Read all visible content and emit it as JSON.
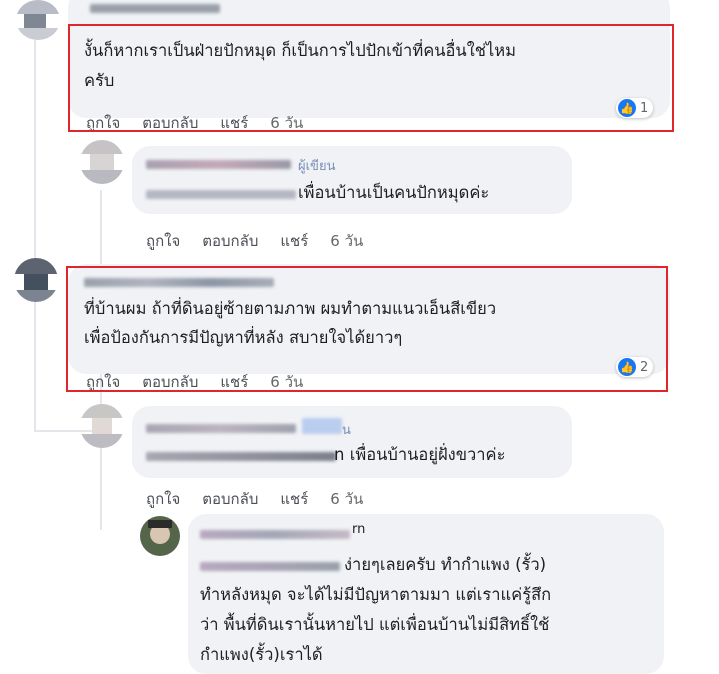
{
  "comments": [
    {
      "lines": [
        "งั้นก็หากเราเป็นฝ่ายปักหมุด ก็เป็นการไปปักเข้าที่คนอื่นใช่ไหม",
        "ครับ"
      ],
      "actions": {
        "like": "ถูกใจ",
        "reply": "ตอบกลับ",
        "share": "แชร์",
        "time": "6 วัน"
      },
      "reaction_count": "1"
    },
    {
      "author_badge": "ผู้เขียน",
      "lines": [
        "เพื่อนบ้านเป็นคนปักหมุดค่ะ"
      ],
      "actions": {
        "like": "ถูกใจ",
        "reply": "ตอบกลับ",
        "share": "แชร์",
        "time": "6 วัน"
      }
    },
    {
      "lines": [
        "ที่บ้านผม ถ้าที่ดินอยู่ซ้ายตามภาพ ผมทำตามแนวเอ็นสีเขียว",
        "เพื่อป้องกันการมีปัญหาที่หลัง สบายใจได้ยาวๆ"
      ],
      "actions": {
        "like": "ถูกใจ",
        "reply": "ตอบกลับ",
        "share": "แชร์",
        "time": "6 วัน"
      },
      "reaction_count": "2"
    },
    {
      "author_fragment": "น",
      "lines": [
        "n เพื่อนบ้านอยู่ฝั่งขวาค่ะ"
      ],
      "actions": {
        "like": "ถูกใจ",
        "reply": "ตอบกลับ",
        "share": "แชร์",
        "time": "6 วัน"
      }
    },
    {
      "author_fragment": "rn",
      "lines": [
        "ง่ายๆเลยครับ ทำกำแพง (รั้ว)",
        "ทำหลังหมุด จะได้ไม่มีปัญหาตามมา แต่เราแค่รู้สึก",
        "ว่า พื้นที่ดินเรานั้นหายไป แต่เพื่อนบ้านไม่มีสิทธิ์ใช้",
        "กำแพง(รั้ว)เราได้"
      ]
    }
  ],
  "colors": {
    "highlight": "#e0262c",
    "bubble": "#f0f2f5",
    "like": "#1877f2"
  }
}
